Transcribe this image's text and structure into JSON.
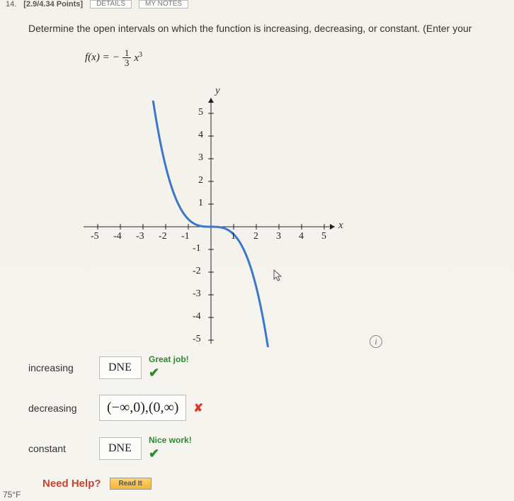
{
  "top": {
    "number": "14.",
    "points": "[2.9/4.34 Points]",
    "btn1": "DETAILS",
    "btn2": "MY NOTES"
  },
  "question": "Determine the open intervals on which the function is increasing, decreasing, or constant. (Enter your",
  "formula": {
    "lhs": "f(x) =",
    "neg": "−",
    "num": "1",
    "den": "3",
    "var": "x",
    "exp": "3"
  },
  "chart_data": {
    "type": "line",
    "title": "",
    "xlabel": "x",
    "ylabel": "y",
    "xlim": [
      -5.5,
      5.5
    ],
    "ylim": [
      -5.5,
      5.5
    ],
    "xticks": [
      -5,
      -4,
      -3,
      -2,
      -1,
      1,
      2,
      3,
      4,
      5
    ],
    "yticks": [
      -5,
      -4,
      -3,
      -2,
      -1,
      1,
      2,
      3,
      4,
      5
    ],
    "series": [
      {
        "name": "f(x) = -(1/3)x^3",
        "x": [
          -2.5,
          -2,
          -1.5,
          -1,
          -0.5,
          0,
          0.5,
          1,
          1.5,
          2,
          2.5
        ],
        "y": [
          5.21,
          2.67,
          1.13,
          0.33,
          0.04,
          0,
          -0.04,
          -0.33,
          -1.13,
          -2.67,
          -5.21
        ]
      }
    ]
  },
  "answers": {
    "increasing": {
      "label": "increasing",
      "value": "DNE",
      "feedback": "Great job!",
      "status": "correct"
    },
    "decreasing": {
      "label": "decreasing",
      "value": "(−∞,0),(0,∞)",
      "feedback": "",
      "status": "wrong"
    },
    "constant": {
      "label": "constant",
      "value": "DNE",
      "feedback": "Nice work!",
      "status": "correct"
    }
  },
  "help": {
    "label": "Need Help?",
    "read": "Read It"
  },
  "temperature": "75°F",
  "icons": {
    "info": "i",
    "check": "✔",
    "x": "✘"
  }
}
